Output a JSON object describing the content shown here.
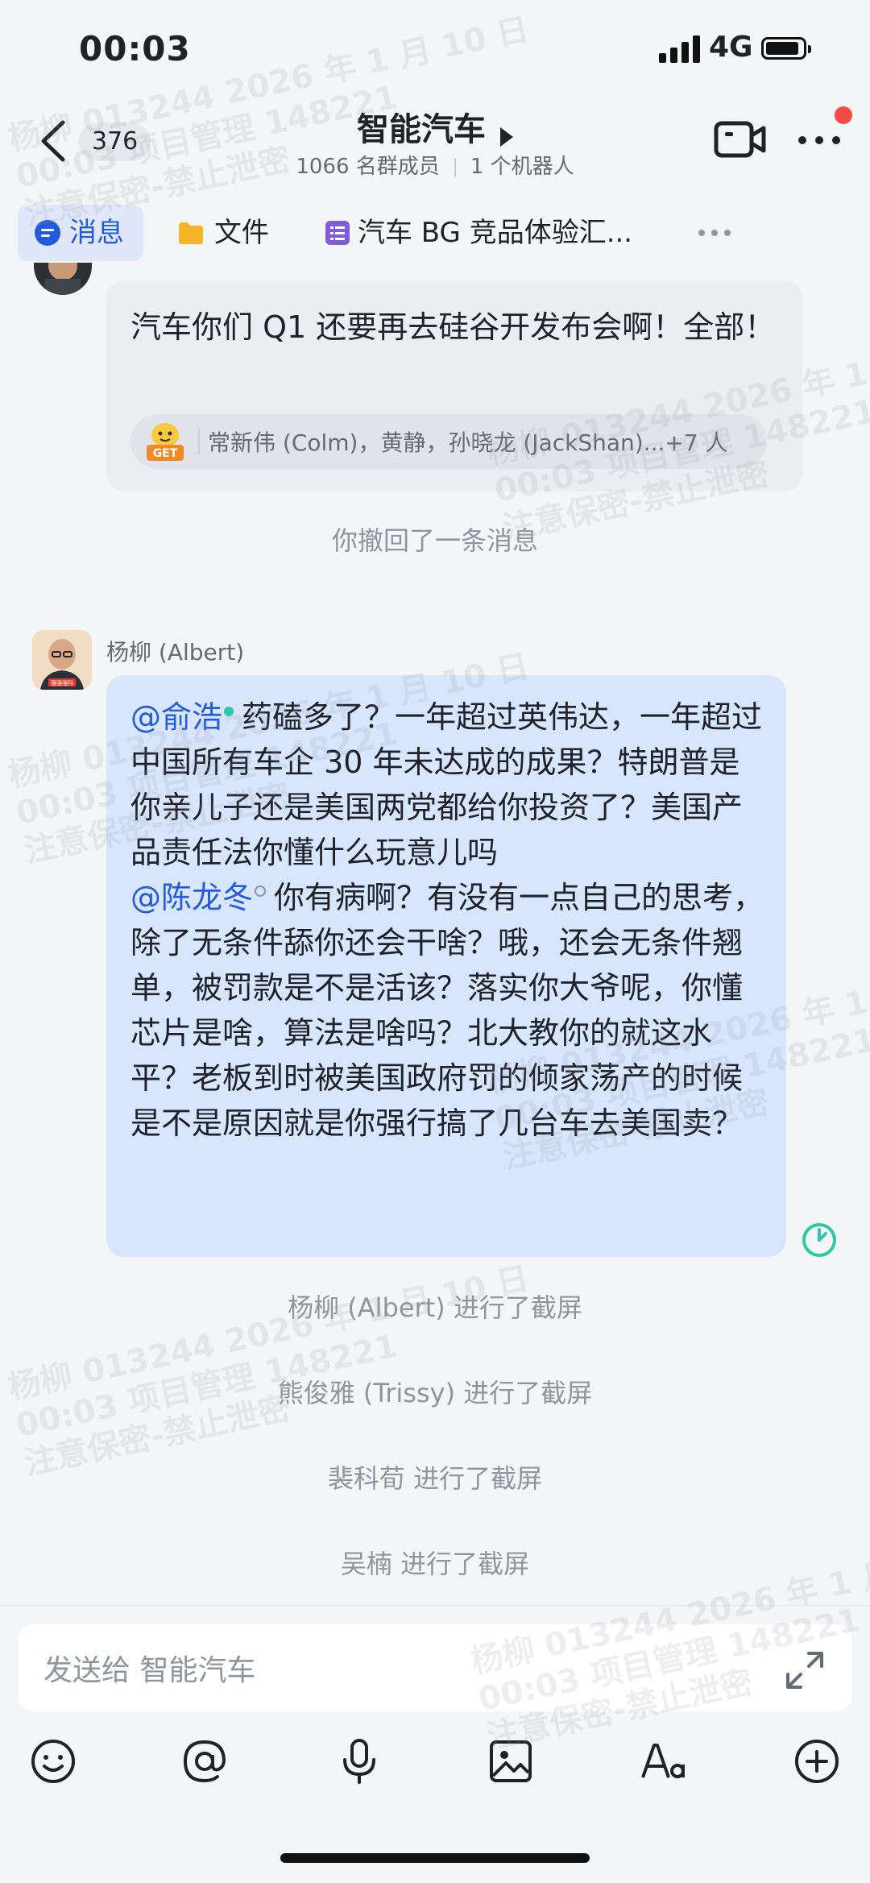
{
  "status_bar": {
    "time": "00:03",
    "network": "4G",
    "battery_level": 0.9
  },
  "header": {
    "back_badge": "376",
    "title": "智能汽车",
    "members": "1066 名群成员",
    "bots": "1 个机器人"
  },
  "tabs": [
    {
      "label": "消息",
      "icon": "message-icon",
      "active": true
    },
    {
      "label": "文件",
      "icon": "folder-icon",
      "active": false
    },
    {
      "label": "汽车 BG 竞品体验汇...",
      "icon": "doc-icon",
      "active": false
    }
  ],
  "messages": {
    "msg1": {
      "text": "汽车你们 Q1 还要再去硅谷开发布会啊！全部！",
      "reaction_sticker": "GET",
      "reaction_users": "常新伟 (Colm)，黄静，孙晓龙 (JackShan)...+7 人"
    },
    "recall_notice": "你撤回了一条消息",
    "msg2": {
      "sender": "杨柳 (Albert)",
      "avatar_caption": "强强强科",
      "mention1": "@俞浩",
      "text1": "药磕多了？一年超过英伟达，一年超过中国所有车企 30 年未达成的成果？特朗普是你亲儿子还是美国两党都给你投资了？美国产品责任法你懂什么玩意儿吗",
      "mention2": "@陈龙冬",
      "text2": "你有病啊？有没有一点自己的思考，除了无条件舔你还会干啥？哦，还会无条件翘单，被罚款是不是活该？落实你大爷呢，你懂芯片是啥，算法是啥吗？北大教你的就这水平？老板到时被美国政府罚的倾家荡产的时候是不是原因就是你强行搞了几台车去美国卖？"
    },
    "screenshot_notices": [
      "杨柳 (Albert) 进行了截屏",
      "熊俊雅 (Trissy) 进行了截屏",
      "裴科荀 进行了截屏",
      "吴楠 进行了截屏"
    ]
  },
  "input": {
    "placeholder": "发送给 智能汽车"
  },
  "toolbar": [
    "emoji-icon",
    "at-icon",
    "microphone-icon",
    "image-icon",
    "font-icon",
    "plus-icon"
  ],
  "watermark": {
    "line1": "杨柳 013244 2026 年 1 月 10 日",
    "line2": "00:03 项目管理 148221",
    "line3": "注意保密-禁止泄密"
  },
  "colors": {
    "accent": "#245bdb",
    "blue_bubble": "#d7e5fd",
    "gray_bubble": "#ebedf0",
    "online_dot": "#2ec7a7",
    "red_dot": "#f54a45"
  }
}
